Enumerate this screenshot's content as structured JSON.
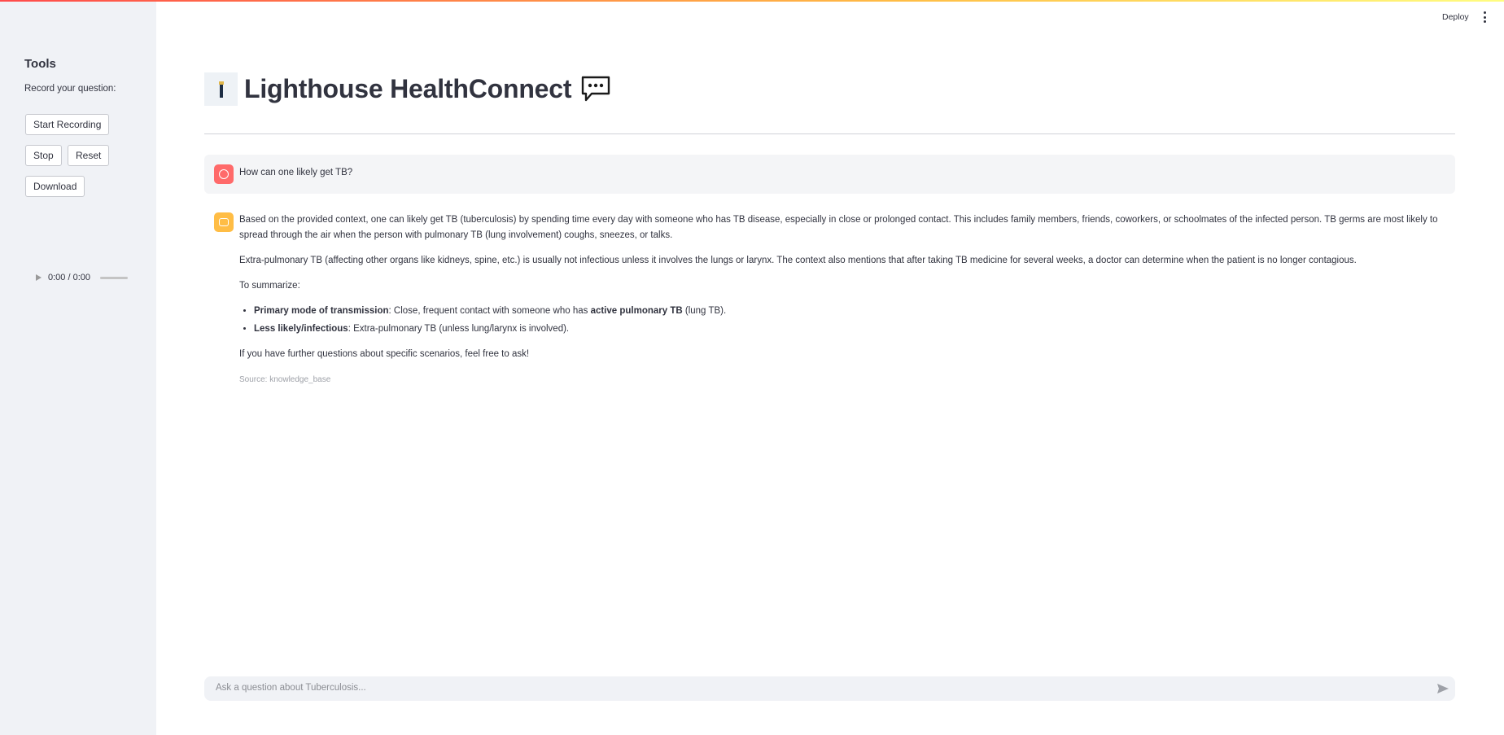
{
  "sidebar": {
    "title": "Tools",
    "subtitle": "Record your question:",
    "buttons": {
      "start": "Start Recording",
      "stop": "Stop",
      "reset": "Reset",
      "download": "Download"
    },
    "audio_time": "0:00 / 0:00"
  },
  "header": {
    "deploy": "Deploy"
  },
  "app": {
    "title": "Lighthouse HealthConnect"
  },
  "chat": {
    "user_question": "How can one likely get TB?",
    "answer": {
      "p1": "Based on the provided context, one can likely get TB (tuberculosis) by spending time every day with someone who has TB disease, especially in close or prolonged contact. This includes family members, friends, coworkers, or schoolmates of the infected person. TB germs are most likely to spread through the air when the person with pulmonary TB (lung involvement) coughs, sneezes, or talks.",
      "p2": "Extra-pulmonary TB (affecting other organs like kidneys, spine, etc.) is usually not infectious unless it involves the lungs or larynx. The context also mentions that after taking TB medicine for several weeks, a doctor can determine when the patient is no longer contagious.",
      "p3": "To summarize:",
      "bullet1_bold": "Primary mode of transmission",
      "bullet1_text_a": ": Close, frequent contact with someone who has ",
      "bullet1_bold2": "active pulmonary TB",
      "bullet1_text_b": " (lung TB).",
      "bullet2_bold": "Less likely/infectious",
      "bullet2_text": ": Extra-pulmonary TB (unless lung/larynx is involved).",
      "p4": "If you have further questions about specific scenarios, feel free to ask!",
      "source": "Source: knowledge_base"
    }
  },
  "input": {
    "placeholder": "Ask a question about Tuberculosis..."
  },
  "colors": {
    "user_avatar": "#ff6a6a",
    "bot_avatar": "#ffbd45",
    "sidebar_bg": "#f0f2f6"
  },
  "icons": {
    "user_avatar": "user-face-icon",
    "bot_avatar": "robot-icon",
    "send": "send-arrow-icon",
    "menu": "kebab-menu-icon",
    "play": "play-icon",
    "speech": "speech-bubble-icon"
  }
}
